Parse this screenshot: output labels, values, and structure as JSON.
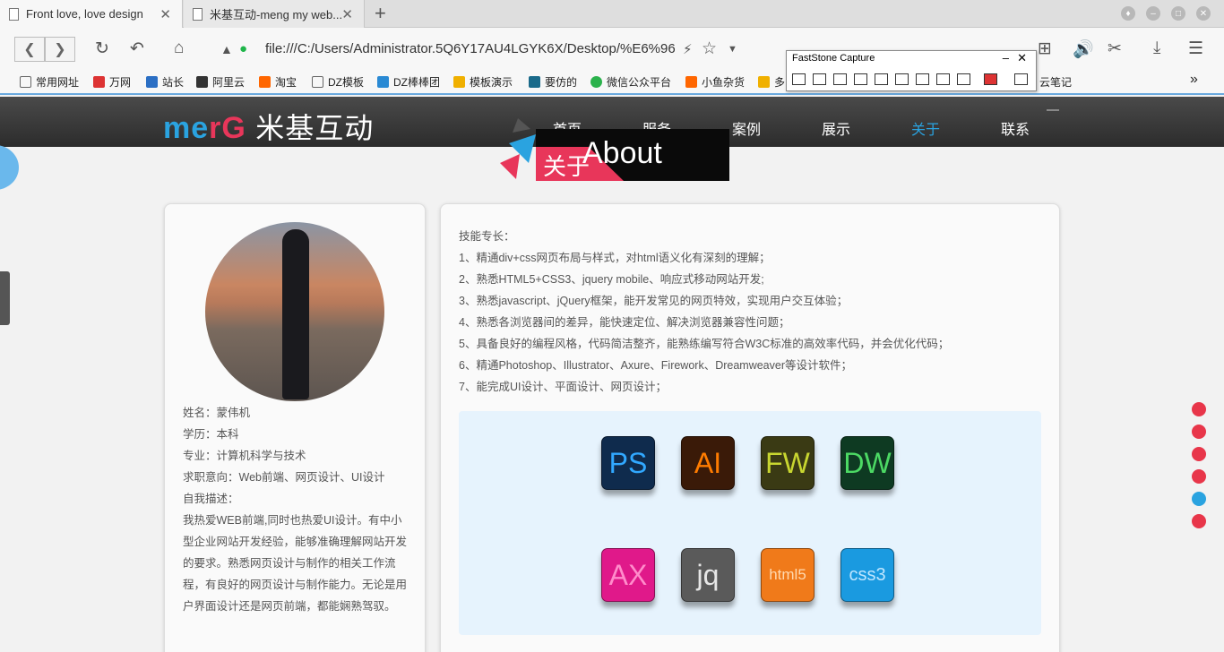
{
  "browser": {
    "tabs": [
      {
        "title": "Front love, love design",
        "close": "✕"
      },
      {
        "title": "米基互动-meng my web...",
        "close": "✕"
      }
    ],
    "new_tab": "+",
    "url": "file:///C:/Users/Administrator.5Q6Y17AU4LGYK6X/Desktop/%E6%96",
    "bookmarks": [
      "常用网址",
      "万网",
      "站长",
      "阿里云",
      "淘宝",
      "DZ模板",
      "DZ棒棒团",
      "模板演示",
      "要仿的",
      "微信公众平台",
      "小鱼杂货",
      "多",
      "云笔记"
    ]
  },
  "faststone": {
    "title": "FastStone Capture"
  },
  "site": {
    "logo": {
      "a": "me",
      "b": "rG",
      "c": "米基互动"
    },
    "menu": [
      "首页",
      "服务",
      "案例",
      "展示",
      "关于",
      "联系"
    ],
    "active_menu_index": 4,
    "banner": {
      "zh": "关于",
      "en": "About"
    }
  },
  "profile": {
    "name": "姓名：蒙伟机",
    "education": "学历：本科",
    "major": "专业：计算机科学与技术",
    "intent": "求职意向：Web前端、网页设计、UI设计",
    "desc_title": "自我描述：",
    "desc_lines": [
      "我热爱WEB前端,同时也热爱UI设计。有中小",
      "型企业网站开发经验，能够准确理解网站开发",
      "的要求。熟悉网页设计与制作的相关工作流",
      "程，有良好的网页设计与制作能力。无论是用",
      "户界面设计还是网页前端，都能娴熟驾驭。"
    ]
  },
  "skills": {
    "title": "技能专长：",
    "items": [
      "1、精通div+css网页布局与样式，对html语义化有深刻的理解；",
      "2、熟悉HTML5+CSS3、jquery mobile、响应式移动网站开发;",
      "3、熟悉javascript、jQuery框架，能开发常见的网页特效，实现用户交互体验；",
      "4、熟悉各浏览器间的差异，能快速定位、解决浏览器兼容性问题；",
      "5、具备良好的编程风格，代码简洁整齐，能熟练编写符合W3C标准的高效率代码，并会优化代码；",
      "6、精通Photoshop、Illustrator、Axure、Firework、Dreamweaver等设计软件；",
      "7、能完成UI设计、平面设计、网页设计；"
    ],
    "icons": [
      {
        "label": "PS",
        "bg": "#0f2b4d",
        "fg": "#31a8ff"
      },
      {
        "label": "AI",
        "bg": "#3a1a08",
        "fg": "#ff7c00"
      },
      {
        "label": "FW",
        "bg": "#3a3a14",
        "fg": "#c8d630"
      },
      {
        "label": "DW",
        "bg": "#0e3a22",
        "fg": "#4cd964"
      },
      {
        "label": "AX",
        "bg": "#e0198a",
        "fg": "#ff8ccb"
      },
      {
        "label": "jq",
        "bg": "#5a5a5a",
        "fg": "#e6e6e6"
      },
      {
        "label": "html5",
        "bg": "#f07a1a",
        "fg": "#ffd9b0"
      },
      {
        "label": "css3",
        "bg": "#1a9ae0",
        "fg": "#bfe6ff"
      }
    ]
  },
  "dots": [
    false,
    false,
    false,
    false,
    true,
    false
  ]
}
